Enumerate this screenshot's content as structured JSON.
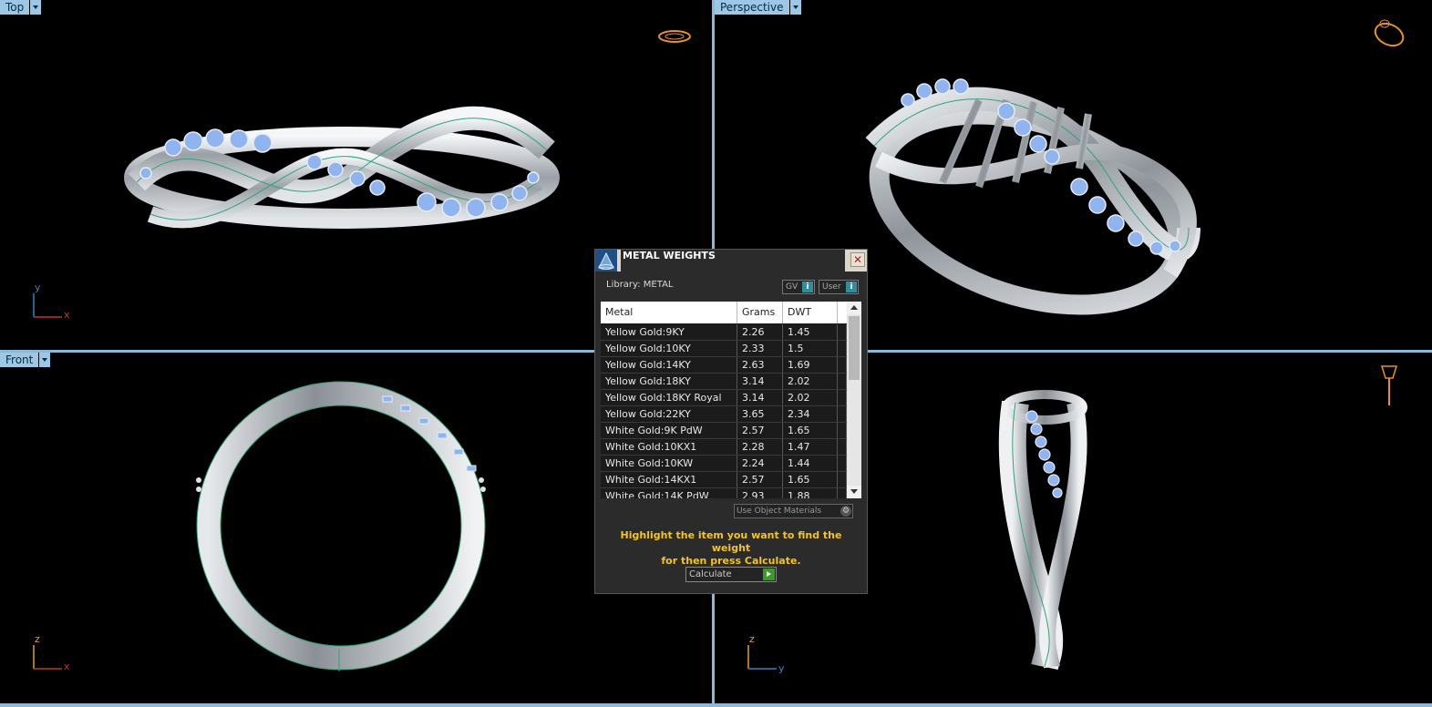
{
  "viewports": {
    "top": {
      "label": "Top",
      "axis_v": "y",
      "axis_h": "x"
    },
    "perspective": {
      "label": "Perspective"
    },
    "front": {
      "label": "Front",
      "axis_v": "z",
      "axis_h": "x"
    },
    "right": {
      "axis_v": "z",
      "axis_h": "y"
    }
  },
  "dialog": {
    "title": "METAL WEIGHTS",
    "library": "Library: METAL",
    "btn_gv": "GV",
    "btn_user": "User",
    "info_glyph": "i",
    "close_glyph": "✕",
    "columns": {
      "metal": "Metal",
      "grams": "Grams",
      "dwt": "DWT"
    },
    "rows": [
      {
        "metal": "Yellow Gold:9KY",
        "grams": "2.26",
        "dwt": "1.45"
      },
      {
        "metal": "Yellow Gold:10KY",
        "grams": "2.33",
        "dwt": "1.5"
      },
      {
        "metal": "Yellow Gold:14KY",
        "grams": "2.63",
        "dwt": "1.69"
      },
      {
        "metal": "Yellow Gold:18KY",
        "grams": "3.14",
        "dwt": "2.02"
      },
      {
        "metal": "Yellow Gold:18KY Royal",
        "grams": "3.14",
        "dwt": "2.02"
      },
      {
        "metal": "Yellow Gold:22KY",
        "grams": "3.65",
        "dwt": "2.34"
      },
      {
        "metal": "White Gold:9K PdW",
        "grams": "2.57",
        "dwt": "1.65"
      },
      {
        "metal": "White Gold:10KX1",
        "grams": "2.28",
        "dwt": "1.47"
      },
      {
        "metal": "White Gold:10KW",
        "grams": "2.24",
        "dwt": "1.44"
      },
      {
        "metal": "White Gold:14KX1",
        "grams": "2.57",
        "dwt": "1.65"
      },
      {
        "metal": "White Gold:14K PdW",
        "grams": "2.93",
        "dwt": "1.88"
      }
    ],
    "use_object_materials": "Use Object Materials",
    "hint_line1": "Highlight the item you want to find the weight",
    "hint_line2": "for then press Calculate.",
    "calculate_label": "Calculate"
  },
  "colors": {
    "viewport_label_bg": "#9cc8e6",
    "divider": "#8eb9d6",
    "hint_text": "#f5c518",
    "axis_x": "#c0392b",
    "axis_y": "#2e86c1",
    "axis_z": "#e0a030",
    "gizmo": "#e8902a",
    "metal": "#c9ccd0",
    "edge": "#2fa37a",
    "gem": "#8fb4f0"
  },
  "icons": {
    "viewport_menu": "chevron-down-icon",
    "dialog_logo": "gemvision-logo-icon",
    "close": "close-icon",
    "info": "info-icon",
    "settings": "gear-icon",
    "calculate": "play-icon"
  }
}
